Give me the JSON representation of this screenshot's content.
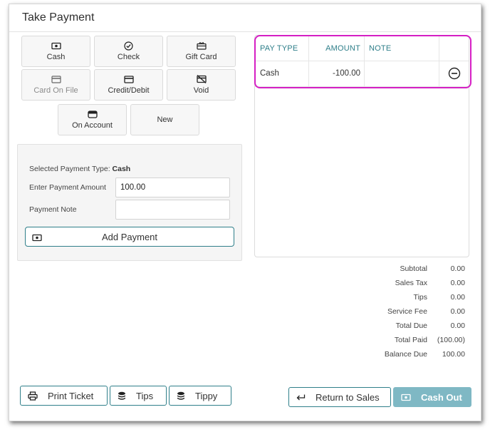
{
  "window": {
    "title": "Take Payment"
  },
  "payment_types": [
    {
      "label": "Cash",
      "icon": "cash-icon"
    },
    {
      "label": "Check",
      "icon": "check-circle-icon"
    },
    {
      "label": "Gift Card",
      "icon": "gift-card-icon"
    },
    {
      "label": "Card On File",
      "icon": "card-icon"
    },
    {
      "label": "Credit/Debit",
      "icon": "credit-card-icon"
    },
    {
      "label": "Void",
      "icon": "void-card-icon"
    },
    {
      "label": "On Account",
      "icon": "wallet-icon"
    },
    {
      "label": "New"
    }
  ],
  "entry": {
    "selected_type_label": "Selected Payment Type:",
    "selected_type_value": "Cash",
    "amount_label": "Enter Payment Amount",
    "amount_value": "100.00",
    "note_label": "Payment Note",
    "note_value": "",
    "add_button": "Add Payment"
  },
  "grid": {
    "headers": [
      "PAY TYPE",
      "AMOUNT",
      "NOTE"
    ],
    "rows": [
      {
        "pay_type": "Cash",
        "amount": "-100.00",
        "note": ""
      }
    ]
  },
  "totals": [
    {
      "label": "Subtotal",
      "value": "0.00"
    },
    {
      "label": "Sales Tax",
      "value": "0.00"
    },
    {
      "label": "Tips",
      "value": "0.00"
    },
    {
      "label": "Service Fee",
      "value": "0.00"
    },
    {
      "label": "Total Due",
      "value": "0.00"
    },
    {
      "label": "Total Paid",
      "value": "(100.00)"
    },
    {
      "label": "Balance Due",
      "value": "100.00"
    }
  ],
  "footer": {
    "print_ticket": "Print Ticket",
    "tips": "Tips",
    "tippy": "Tippy",
    "return_to_sales": "Return to Sales",
    "cash_out": "Cash Out"
  },
  "colors": {
    "accent": "#2f7f8a",
    "highlight": "#d51fc4",
    "cash_out_bg": "#7fb8c4"
  }
}
